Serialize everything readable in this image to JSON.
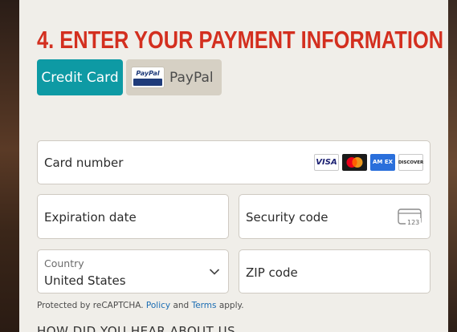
{
  "section": {
    "heading": "4. ENTER YOUR PAYMENT INFORMATION"
  },
  "tabs": {
    "credit_card": "Credit Card",
    "paypal": "PayPal",
    "paypal_logo_text": "PayPal"
  },
  "fields": {
    "card_number": "Card number",
    "expiration": "Expiration date",
    "security": "Security code",
    "country_label": "Country",
    "country_value": "United States",
    "zip": "ZIP code"
  },
  "card_brands": {
    "visa": "VISA",
    "amex": "AM EX",
    "discover": "DISCOVER"
  },
  "cvv_icon_text": "123",
  "recaptcha": {
    "prefix": "Protected by reCAPTCHA.",
    "policy": "Policy",
    "and": "and",
    "terms": "Terms",
    "suffix": "apply."
  },
  "next_section": "HOW DID YOU HEAR ABOUT US",
  "colors": {
    "heading": "#d32f1f",
    "active_tab": "#0e9aa4",
    "inactive_tab": "#d6d0c4",
    "link": "#1b6db3",
    "panel": "#f0eee9"
  }
}
